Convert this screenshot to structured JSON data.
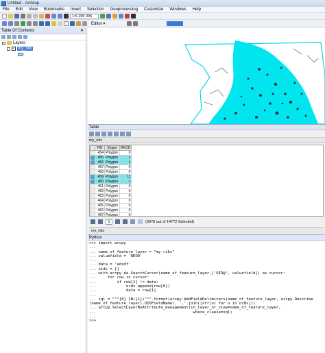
{
  "window": {
    "title": "Untitled - ArcMap"
  },
  "menu": [
    "File",
    "Edit",
    "View",
    "Bookmarks",
    "Insert",
    "Selection",
    "Geoprocessing",
    "Customize",
    "Windows",
    "Help"
  ],
  "toolbar": {
    "scale": "1:6 195 096",
    "editor_label": "Editor ▾"
  },
  "toc": {
    "title": "Table Of Contents",
    "close_glyph": "✕",
    "root": "Layers",
    "layer": "my_riks"
  },
  "table_window": {
    "title": "Table",
    "layer_tab": "my_riks",
    "columns": [
      "FID",
      "Shape",
      "RKOD"
    ],
    "rows": [
      {
        "fid": "454",
        "shape": "Polygon",
        "rkod": "0",
        "selected": false
      },
      {
        "fid": "455",
        "shape": "Polygon",
        "rkod": "1",
        "selected": true
      },
      {
        "fid": "456",
        "shape": "Polygon",
        "rkod": "1",
        "selected": true
      },
      {
        "fid": "457",
        "shape": "Polygon",
        "rkod": "0",
        "selected": false
      },
      {
        "fid": "458",
        "shape": "Polygon",
        "rkod": "0",
        "selected": false
      },
      {
        "fid": "459",
        "shape": "Polygon",
        "rkod": "11",
        "selected": true
      },
      {
        "fid": "460",
        "shape": "Polygon",
        "rkod": "1",
        "selected": true
      },
      {
        "fid": "461",
        "shape": "Polygon",
        "rkod": "0",
        "selected": false
      },
      {
        "fid": "462",
        "shape": "Polygon",
        "rkod": "0",
        "selected": false
      },
      {
        "fid": "463",
        "shape": "Polygon",
        "rkod": "0",
        "selected": false
      },
      {
        "fid": "464",
        "shape": "Polygon",
        "rkod": "0",
        "selected": false
      },
      {
        "fid": "465",
        "shape": "Polygon",
        "rkod": "0",
        "selected": false
      },
      {
        "fid": "466",
        "shape": "Polygon",
        "rkod": "0",
        "selected": false
      },
      {
        "fid": "467",
        "shape": "Polygon",
        "rkod": "0",
        "selected": false
      },
      {
        "fid": "468",
        "shape": "Polygon",
        "rkod": "11",
        "selected": true
      },
      {
        "fid": "469",
        "shape": "Polygon",
        "rkod": "1",
        "selected": true
      },
      {
        "fid": "470",
        "shape": "Polygon",
        "rkod": "0",
        "selected": false
      }
    ],
    "page": "1",
    "status": "(3978 out of 14772 Selected)",
    "footer_tab": "my_riks"
  },
  "python": {
    "title": "Python",
    "lines": [
      ">>> import arcpy",
      "...",
      "... name_of_feature_layer = \"my_riks\"",
      "... valuefield = 'RKOD'",
      "...",
      "... data = 'adsdf'",
      "... oids = []",
      "... with arcpy.da.SearchCursor(name_of_feature_layer,['OID@', valuefield]) as cursor:",
      "...     for row in cursor:",
      "...         if row[1] != data:",
      "...             oids.append(row[0])",
      "...             data = row[1]",
      "...",
      "... sql = \"\"\"{0} IN({1})\"\"\".format(arcpy.AddFieldDelimiters(name_of_feature_layer, arcpy.Describe",
      "(name_of_feature_layer).OIDFieldName), ','.join([str(o) for o in oids]))",
      "... arcpy.SelectLayerByAttribute_management(in_layer_or_view=name_of_feature_layer,",
      "...                                          where_clause=sql)",
      "...",
      ">>>"
    ]
  },
  "colors": {
    "selection": "#00e5ee",
    "map_outline": "#00d8e8"
  }
}
